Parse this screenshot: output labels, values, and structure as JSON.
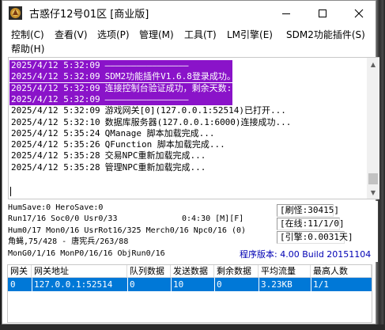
{
  "window": {
    "title": "古惑仔12号01区 [商业版]",
    "controls": {
      "minimize": "minimize",
      "maximize": "maximize",
      "close": "close"
    }
  },
  "menu": {
    "items": [
      "控制(C)",
      "查看(V)",
      "选项(P)",
      "管理(M)",
      "工具(T)",
      "LM引擎(E)",
      "SDM2功能插件(S)",
      "帮助(H)"
    ]
  },
  "log": {
    "lines": [
      {
        "time": "2025/4/12 5:32:09",
        "text": "————————————————",
        "selected": true
      },
      {
        "time": "2025/4/12 5:32:09",
        "text": "SDM2功能插件V1.6.8登录成功。",
        "selected": true
      },
      {
        "time": "2025/4/12 5:32:09",
        "text": "连接控制台验证成功，剩余天数:90天",
        "selected": true
      },
      {
        "time": "2025/4/12 5:32:09",
        "text": "————————————————",
        "selected": true
      },
      {
        "time": "2025/4/12 5:32:09",
        "text": "游戏网关[0](127.0.0.1:52514)已打开...",
        "selected": false
      },
      {
        "time": "2025/4/12 5:32:10",
        "text": "数据库服务器(127.0.0.1:6000)连接成功...",
        "selected": false
      },
      {
        "time": "2025/4/12 5:35:24",
        "text": "QManage 脚本加载完成...",
        "selected": false
      },
      {
        "time": "2025/4/12 5:35:26",
        "text": "QFunction 脚本加载完成...",
        "selected": false
      },
      {
        "time": "2025/4/12 5:35:28",
        "text": "交易NPC重新加载完成...",
        "selected": false
      },
      {
        "time": "2025/4/12 5:35:28",
        "text": "管理NPC重新加载完成...",
        "selected": false
      }
    ]
  },
  "status": {
    "line1": "HumSave:0 HeroSave:0",
    "line2": "Run17/16 Soc0/0 Usr0/33",
    "uptime": "0:4:30 [M][F]",
    "line3": "Hum0/17 Mon0/16 UsrRot16/325 Merch0/16 Npc0/16 (0)",
    "line4": "角蝇,75/428 - 唐宪兵/263/88",
    "line5": "MonG0/1/16 MonP0/16/16 ObjRun0/16",
    "refresh": "[刷怪:30415]",
    "online": "[在线:11/1/0]",
    "engine": "[引擎:0.0031天]",
    "version": "程序版本: 4.00 Build 20151104"
  },
  "gateway": {
    "headers": [
      "网关",
      "网关地址",
      "队列数据",
      "发送数据",
      "剩余数据",
      "平均流量",
      "最高人数"
    ],
    "rows": [
      [
        "0",
        "127.0.0.1:52514",
        "0",
        "10",
        "0",
        "3.23KB",
        "1/1"
      ]
    ]
  },
  "colors": {
    "selection": "#8a13c9",
    "row_highlight": "#0078d7",
    "version_text": "#0000b4"
  }
}
